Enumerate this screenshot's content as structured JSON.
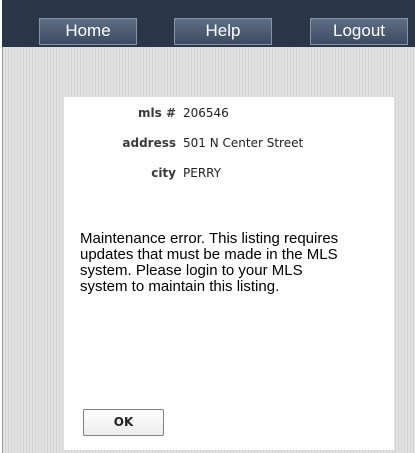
{
  "nav": {
    "home_label": "Home",
    "help_label": "Help",
    "logout_label": "Logout"
  },
  "listing": {
    "mls_label": "mls #",
    "mls_value": "206546",
    "address_label": "address",
    "address_value": "501 N Center Street",
    "city_label": "city",
    "city_value": "PERRY"
  },
  "dialog": {
    "message": "Maintenance error. This listing requires updates that must be made in the MLS system. Please login to your MLS system to maintain this listing.",
    "ok_label": "OK"
  }
}
